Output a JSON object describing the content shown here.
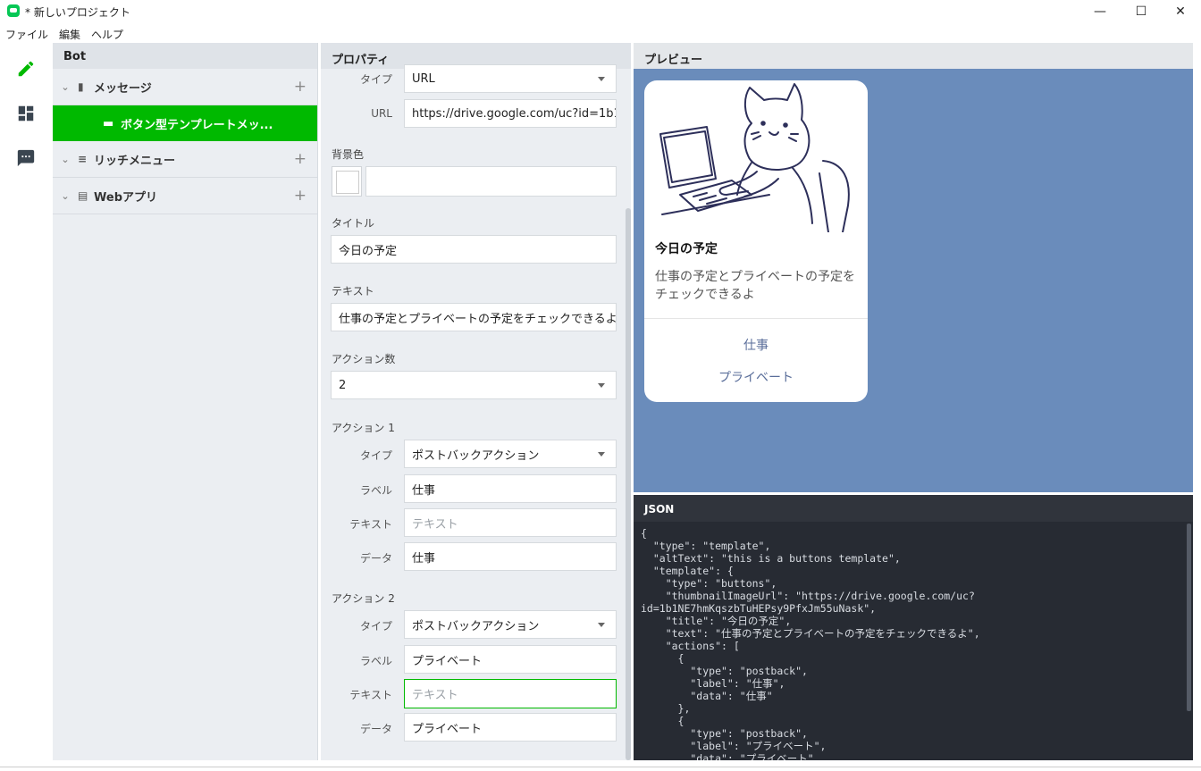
{
  "window": {
    "title": "* 新しいプロジェクト",
    "controls": {
      "minimize": "—",
      "maximize": "☐",
      "close": "✕"
    }
  },
  "menu": [
    "ファイル",
    "編集",
    "ヘルプ"
  ],
  "rail": {
    "icons": [
      "pencil-icon",
      "dashboard-icon",
      "chat-icon"
    ],
    "accent": "#00b900"
  },
  "tree": {
    "header": "Bot",
    "items": [
      {
        "label": "メッセージ",
        "icon": "message-icon"
      },
      {
        "label": "リッチメニュー",
        "icon": "list-icon"
      },
      {
        "label": "Webアプリ",
        "icon": "webapp-icon"
      }
    ],
    "selected_child": "ボタン型テンプレートメッ..."
  },
  "props": {
    "header": "プロパティ",
    "type_label": "タイプ",
    "type_value": "URL",
    "url_label": "URL",
    "url_value": "https://drive.google.com/uc?id=1b1NE",
    "bgcolor_label": "背景色",
    "bgcolor_value": "",
    "title_label": "タイトル",
    "title_value": "今日の予定",
    "text_label": "テキスト",
    "text_value": "仕事の予定とプライベートの予定をチェックできるよ",
    "action_count_label": "アクション数",
    "action_count_value": "2",
    "actions": [
      {
        "heading": "アクション 1",
        "type_label": "タイプ",
        "type_value": "ポストバックアクション",
        "label_label": "ラベル",
        "label_value": "仕事",
        "text_label": "テキスト",
        "text_placeholder": "テキスト",
        "data_label": "データ",
        "data_value": "仕事"
      },
      {
        "heading": "アクション 2",
        "type_label": "タイプ",
        "type_value": "ポストバックアクション",
        "label_label": "ラベル",
        "label_value": "プライベート",
        "text_label": "テキスト",
        "text_placeholder": "テキスト",
        "data_label": "データ",
        "data_value": "プライベート"
      }
    ]
  },
  "preview": {
    "header": "プレビュー",
    "card_title": "今日の予定",
    "card_text": "仕事の予定とプライベートの予定をチェックできるよ",
    "actions": [
      "仕事",
      "プライベート"
    ],
    "background": "#6a8cbb"
  },
  "json_panel": {
    "header": "JSON",
    "code": "{\n  \"type\": \"template\",\n  \"altText\": \"this is a buttons template\",\n  \"template\": {\n    \"type\": \"buttons\",\n    \"thumbnailImageUrl\": \"https://drive.google.com/uc?\nid=1b1NE7hmKqszbTuHEPsy9PfxJm55uNask\",\n    \"title\": \"今日の予定\",\n    \"text\": \"仕事の予定とプライベートの予定をチェックできるよ\",\n    \"actions\": [\n      {\n        \"type\": \"postback\",\n        \"label\": \"仕事\",\n        \"data\": \"仕事\"\n      },\n      {\n        \"type\": \"postback\",\n        \"label\": \"プライベート\",\n        \"data\": \"プライベート\""
  }
}
